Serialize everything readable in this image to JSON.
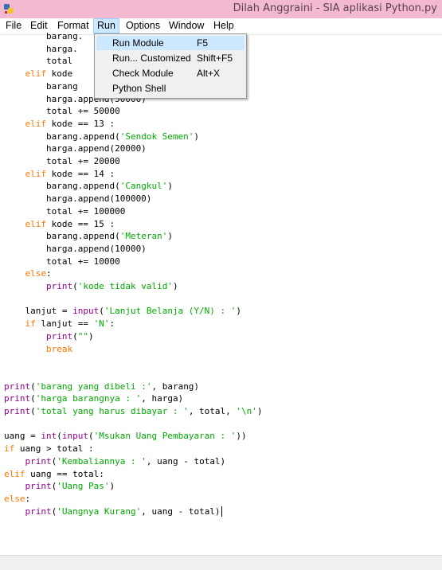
{
  "window": {
    "title": "Dilah Anggraini - SIA aplikasi Python.py"
  },
  "menu": {
    "file": "File",
    "edit": "Edit",
    "format": "Format",
    "run": "Run",
    "options": "Options",
    "window": "Window",
    "help": "Help"
  },
  "run_menu": {
    "items": [
      {
        "label": "Run Module",
        "shortcut": "F5"
      },
      {
        "label": "Run... Customized",
        "shortcut": "Shift+F5"
      },
      {
        "label": "Check Module",
        "shortcut": "Alt+X"
      },
      {
        "label": "Python Shell",
        "shortcut": ""
      }
    ]
  },
  "code": {
    "lines": [
      "        barang.",
      "        harga.",
      "        total",
      "    elif kode",
      "        barang",
      "        harga.append(50000)",
      "        total += 50000",
      "    elif kode == 13 :",
      "        barang.append('Sendok Semen')",
      "        harga.append(20000)",
      "        total += 20000",
      "    elif kode == 14 :",
      "        barang.append('Cangkul')",
      "        harga.append(100000)",
      "        total += 100000",
      "    elif kode == 15 :",
      "        barang.append('Meteran')",
      "        harga.append(10000)",
      "        total += 10000",
      "    else:",
      "        print('kode tidak valid')",
      "",
      "    lanjut = input('Lanjut Belanja (Y/N) : ')",
      "    if lanjut == 'N':",
      "        print(\"\")",
      "        break",
      "",
      "",
      "print('barang yang dibeli :', barang)",
      "print('harga barangnya : ', harga)",
      "print('total yang harus dibayar : ', total, '\\n')",
      "",
      "uang = int(input('Msukan Uang Pembayaran : '))",
      "if uang > total :",
      "    print('Kembaliannya : ', uang - total)",
      "elif uang == total:",
      "    print('Uang Pas')",
      "else:",
      "    print('Uangnya Kurang', uang - total)"
    ]
  },
  "colors": {
    "keyword": "#ff7700",
    "string": "#00aa00",
    "builtin": "#900090",
    "titlebar": "#f3b9d0",
    "menu_highlight": "#cce8ff"
  }
}
